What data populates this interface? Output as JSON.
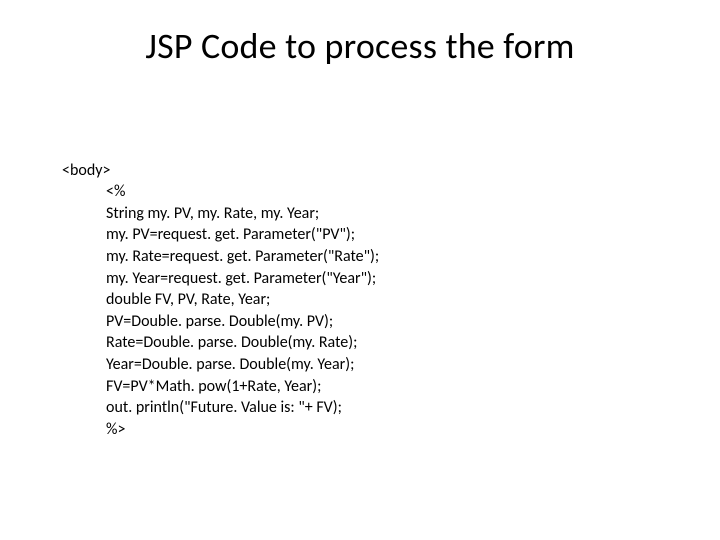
{
  "title": "JSP Code to process the form",
  "code": {
    "line0": "<body>",
    "line1": "<%",
    "line2": "String my. PV, my. Rate, my. Year;",
    "line3": "my. PV=request. get. Parameter(\"PV\");",
    "line4": "my. Rate=request. get. Parameter(\"Rate\");",
    "line5": "my. Year=request. get. Parameter(\"Year\");",
    "line6": "double FV, PV, Rate, Year;",
    "line7": "PV=Double. parse. Double(my. PV);",
    "line8": "Rate=Double. parse. Double(my. Rate);",
    "line9": "Year=Double. parse. Double(my. Year);",
    "line10": "FV=PV*Math. pow(1+Rate, Year);",
    "line11": "out. println(\"Future. Value is: \"+ FV);",
    "line12": "%>"
  }
}
